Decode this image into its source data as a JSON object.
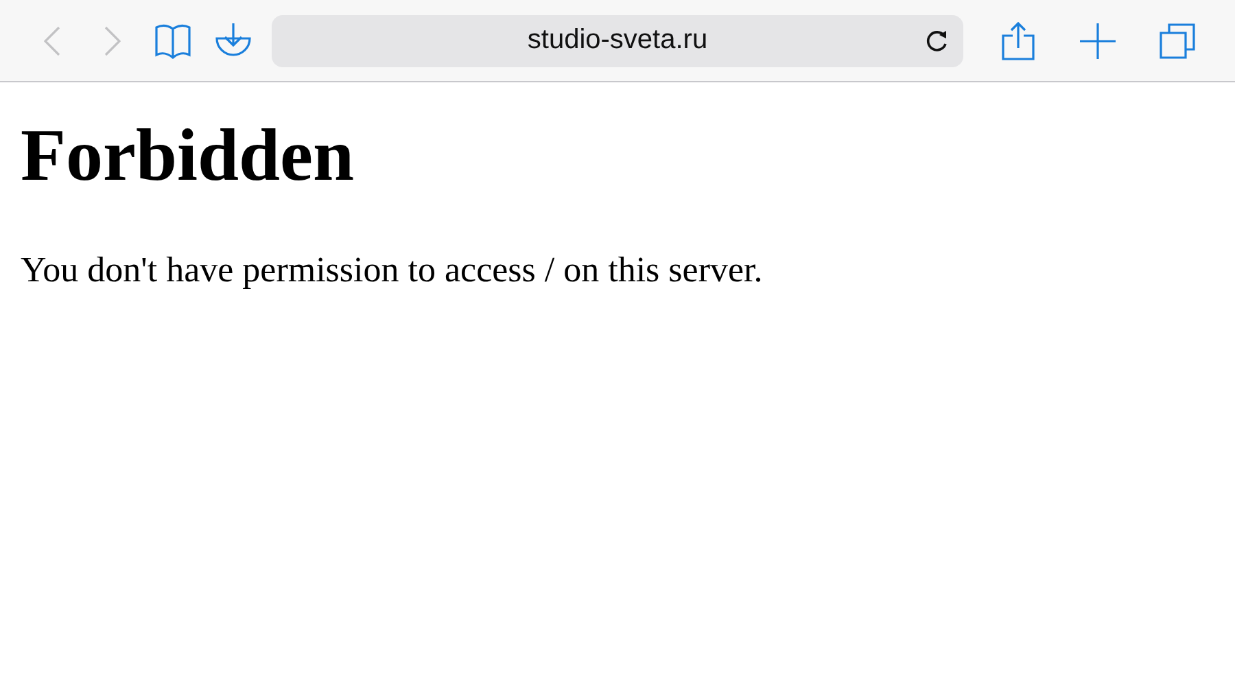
{
  "toolbar": {
    "buttons": [
      {
        "kind": "back",
        "disabled": true
      },
      {
        "kind": "forward",
        "disabled": true
      },
      {
        "kind": "bookmarks",
        "disabled": false
      },
      {
        "kind": "download",
        "disabled": false
      }
    ],
    "address": "studio-sveta.ru",
    "right_buttons": [
      {
        "kind": "share",
        "disabled": false
      },
      {
        "kind": "new-tab",
        "disabled": false
      },
      {
        "kind": "tabs",
        "disabled": false
      }
    ]
  },
  "page": {
    "heading": "Forbidden",
    "message": "You don't have permission to access / on this server."
  }
}
